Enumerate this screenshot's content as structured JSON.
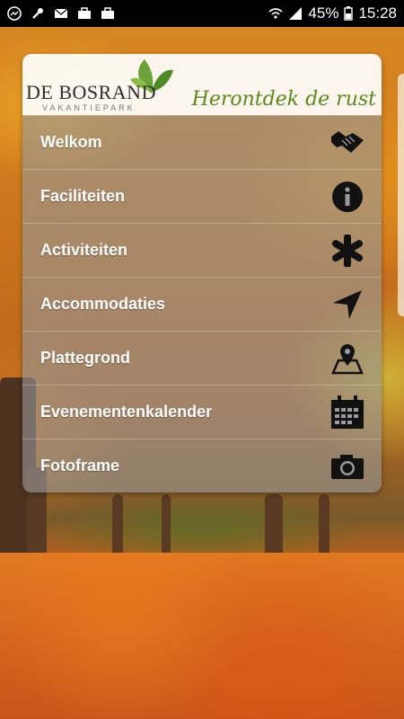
{
  "statusbar": {
    "battery": "45%",
    "time": "15:28",
    "left_icons": [
      "messenger-icon",
      "wrench-icon",
      "mail-icon",
      "briefcase-icon",
      "briefcase-icon"
    ],
    "right_icons": [
      "wifi-icon",
      "signal-icon",
      "battery-icon"
    ]
  },
  "header": {
    "brand": "DE BOSRAND",
    "brand_sub": "VAKANTIEPARK",
    "tagline": "Herontdek de rust"
  },
  "menu": {
    "items": [
      {
        "label": "Welkom",
        "icon": "handshake-icon"
      },
      {
        "label": "Faciliteiten",
        "icon": "info-icon"
      },
      {
        "label": "Activiteiten",
        "icon": "asterisk-icon"
      },
      {
        "label": "Accommodaties",
        "icon": "navigation-arrow-icon"
      },
      {
        "label": "Plattegrond",
        "icon": "map-pin-icon"
      },
      {
        "label": "Evenementenkalender",
        "icon": "calendar-icon"
      },
      {
        "label": "Fotoframe",
        "icon": "camera-icon"
      }
    ]
  },
  "colors": {
    "tagline": "#5a8a1e",
    "menu_bg": "rgba(150,150,150,0.62)",
    "icon": "#111111"
  }
}
